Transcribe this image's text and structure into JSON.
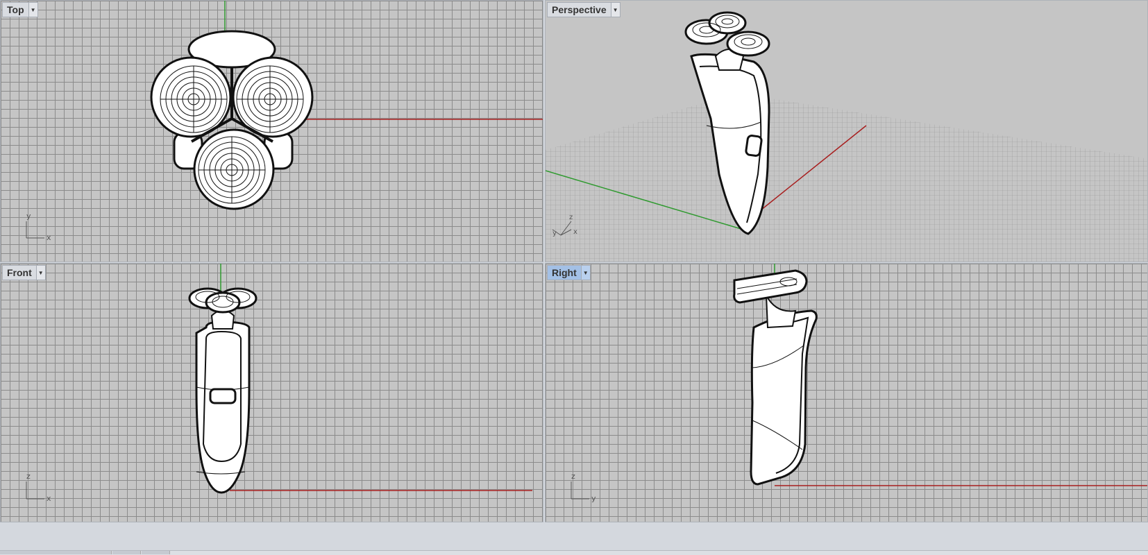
{
  "viewports": {
    "top": {
      "label": "Top",
      "axes": {
        "a": "y",
        "b": "x"
      },
      "active": false
    },
    "persp": {
      "label": "Perspective",
      "axes": {
        "a": "z",
        "b": "y",
        "c": "x"
      },
      "active": false
    },
    "front": {
      "label": "Front",
      "axes": {
        "a": "z",
        "b": "x"
      },
      "active": false
    },
    "right": {
      "label": "Right",
      "axes": {
        "a": "z",
        "b": "y"
      },
      "active": true
    }
  },
  "menu_icon": "triangle-down-icon",
  "colors": {
    "x_axis": "#a81e1e",
    "y_axis": "#2e9a2e",
    "grid": "#8b8b8b",
    "background": "#c5c5c5",
    "active_tab": "#a3c0e6",
    "model_fill": "#ffffff",
    "model_stroke": "#111111"
  }
}
